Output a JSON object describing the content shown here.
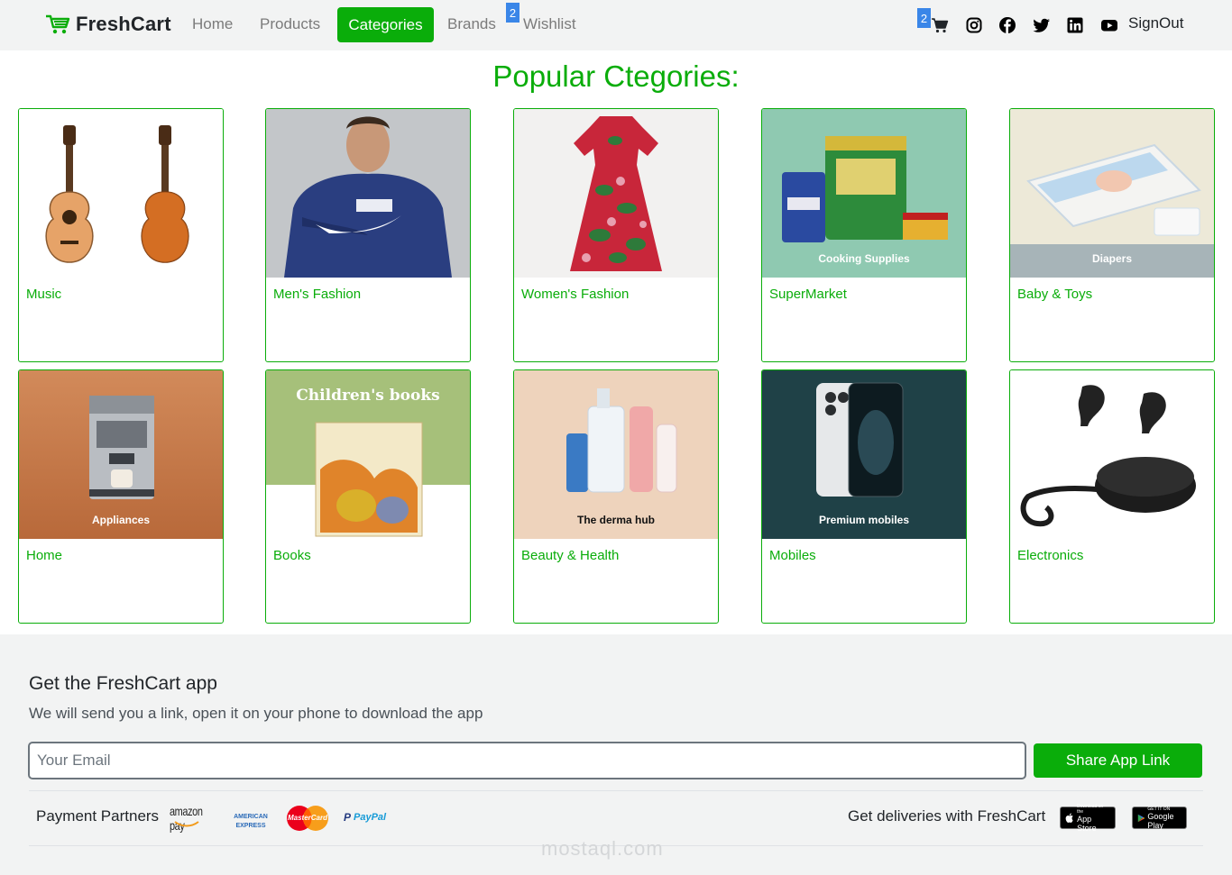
{
  "navbar": {
    "brand": "FreshCart",
    "links": [
      "Home",
      "Products",
      "Categories",
      "Brands",
      "Wishlist"
    ],
    "active_link": "Categories",
    "wishlist_count": "2",
    "cart_count": "2",
    "signout": "SignOut",
    "social_icons": [
      "instagram-icon",
      "facebook-icon",
      "twitter-icon",
      "linkedin-icon",
      "youtube-icon"
    ]
  },
  "heading": "Popular Ctegories:",
  "categories": [
    {
      "label": "Music",
      "image_caption": ""
    },
    {
      "label": "Men's Fashion",
      "image_caption": ""
    },
    {
      "label": "Women's Fashion",
      "image_caption": ""
    },
    {
      "label": "SuperMarket",
      "image_caption": "Cooking Supplies"
    },
    {
      "label": "Baby & Toys",
      "image_caption": "Diapers"
    },
    {
      "label": "Home",
      "image_caption": "Appliances"
    },
    {
      "label": "Books",
      "image_caption": "Children's books"
    },
    {
      "label": "Beauty & Health",
      "image_caption": "The derma hub"
    },
    {
      "label": "Mobiles",
      "image_caption": "Premium mobiles"
    },
    {
      "label": "Electronics",
      "image_caption": ""
    }
  ],
  "footer": {
    "title": "Get the FreshCart app",
    "subtitle": "We will send you a link, open it on your phone to download the app",
    "email_placeholder": "Your Email",
    "share_button": "Share App Link",
    "payment_label": "Payment Partners",
    "payment_partners": [
      "amazon pay",
      "AMERICAN EXPRESS",
      "MasterCard",
      "PayPal"
    ],
    "deliveries_label": "Get deliveries with FreshCart",
    "app_store": {
      "small": "Download on the",
      "big": "App Store"
    },
    "google_play": {
      "small": "GET IT ON",
      "big": "Google Play"
    },
    "watermark": "mostaql.com"
  },
  "colors": {
    "accent": "#0aad0a",
    "navbar_bg": "#f2f3f3",
    "badge": "#3a86e8"
  }
}
